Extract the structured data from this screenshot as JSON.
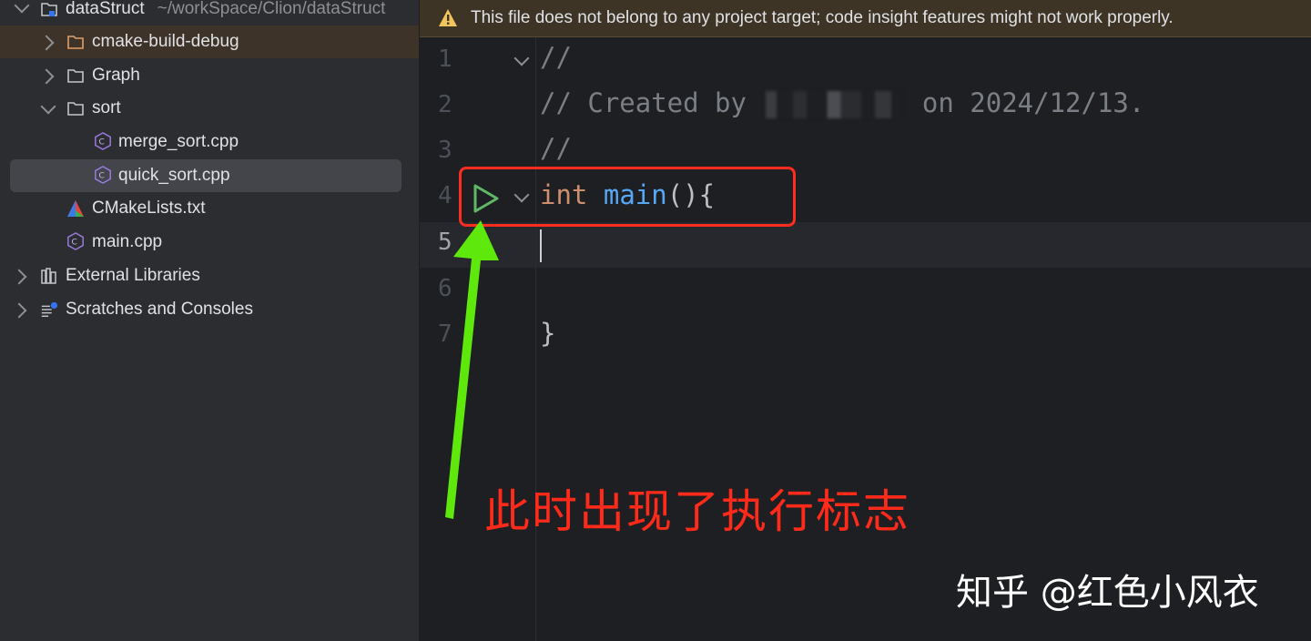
{
  "project_tree": {
    "root": {
      "label": "dataStruct",
      "path": "~/workSpace/Clion/dataStruct"
    },
    "items": [
      {
        "label": "cmake-build-debug",
        "icon": "folder-icon"
      },
      {
        "label": "Graph",
        "icon": "folder-icon"
      },
      {
        "label": "sort",
        "icon": "folder-icon"
      },
      {
        "label": "merge_sort.cpp",
        "icon": "cpp-file-icon"
      },
      {
        "label": "quick_sort.cpp",
        "icon": "cpp-file-icon"
      },
      {
        "label": "CMakeLists.txt",
        "icon": "cmake-icon"
      },
      {
        "label": "main.cpp",
        "icon": "cpp-file-icon"
      },
      {
        "label": "External Libraries",
        "icon": "libraries-icon"
      },
      {
        "label": "Scratches and Consoles",
        "icon": "scratches-icon"
      }
    ]
  },
  "editor": {
    "warning_banner": "This file does not belong to any project target; code insight features might not work properly.",
    "line_numbers": [
      "1",
      "2",
      "3",
      "4",
      "5",
      "6",
      "7"
    ],
    "code": {
      "line1": "//",
      "line2_prefix": "// Created by ",
      "line2_suffix": " on 2024/12/13.",
      "line3": "//",
      "line4_keyword": "int",
      "line4_fn": "main",
      "line4_rest": "(){",
      "line7": "}"
    }
  },
  "annotation": {
    "text": "此时出现了执行标志",
    "watermark": "知乎 @红色小风衣"
  },
  "colors": {
    "annotation_red": "#ff2a1a",
    "arrow_green": "#5ee80c",
    "run_icon_green": "#5fb865"
  }
}
